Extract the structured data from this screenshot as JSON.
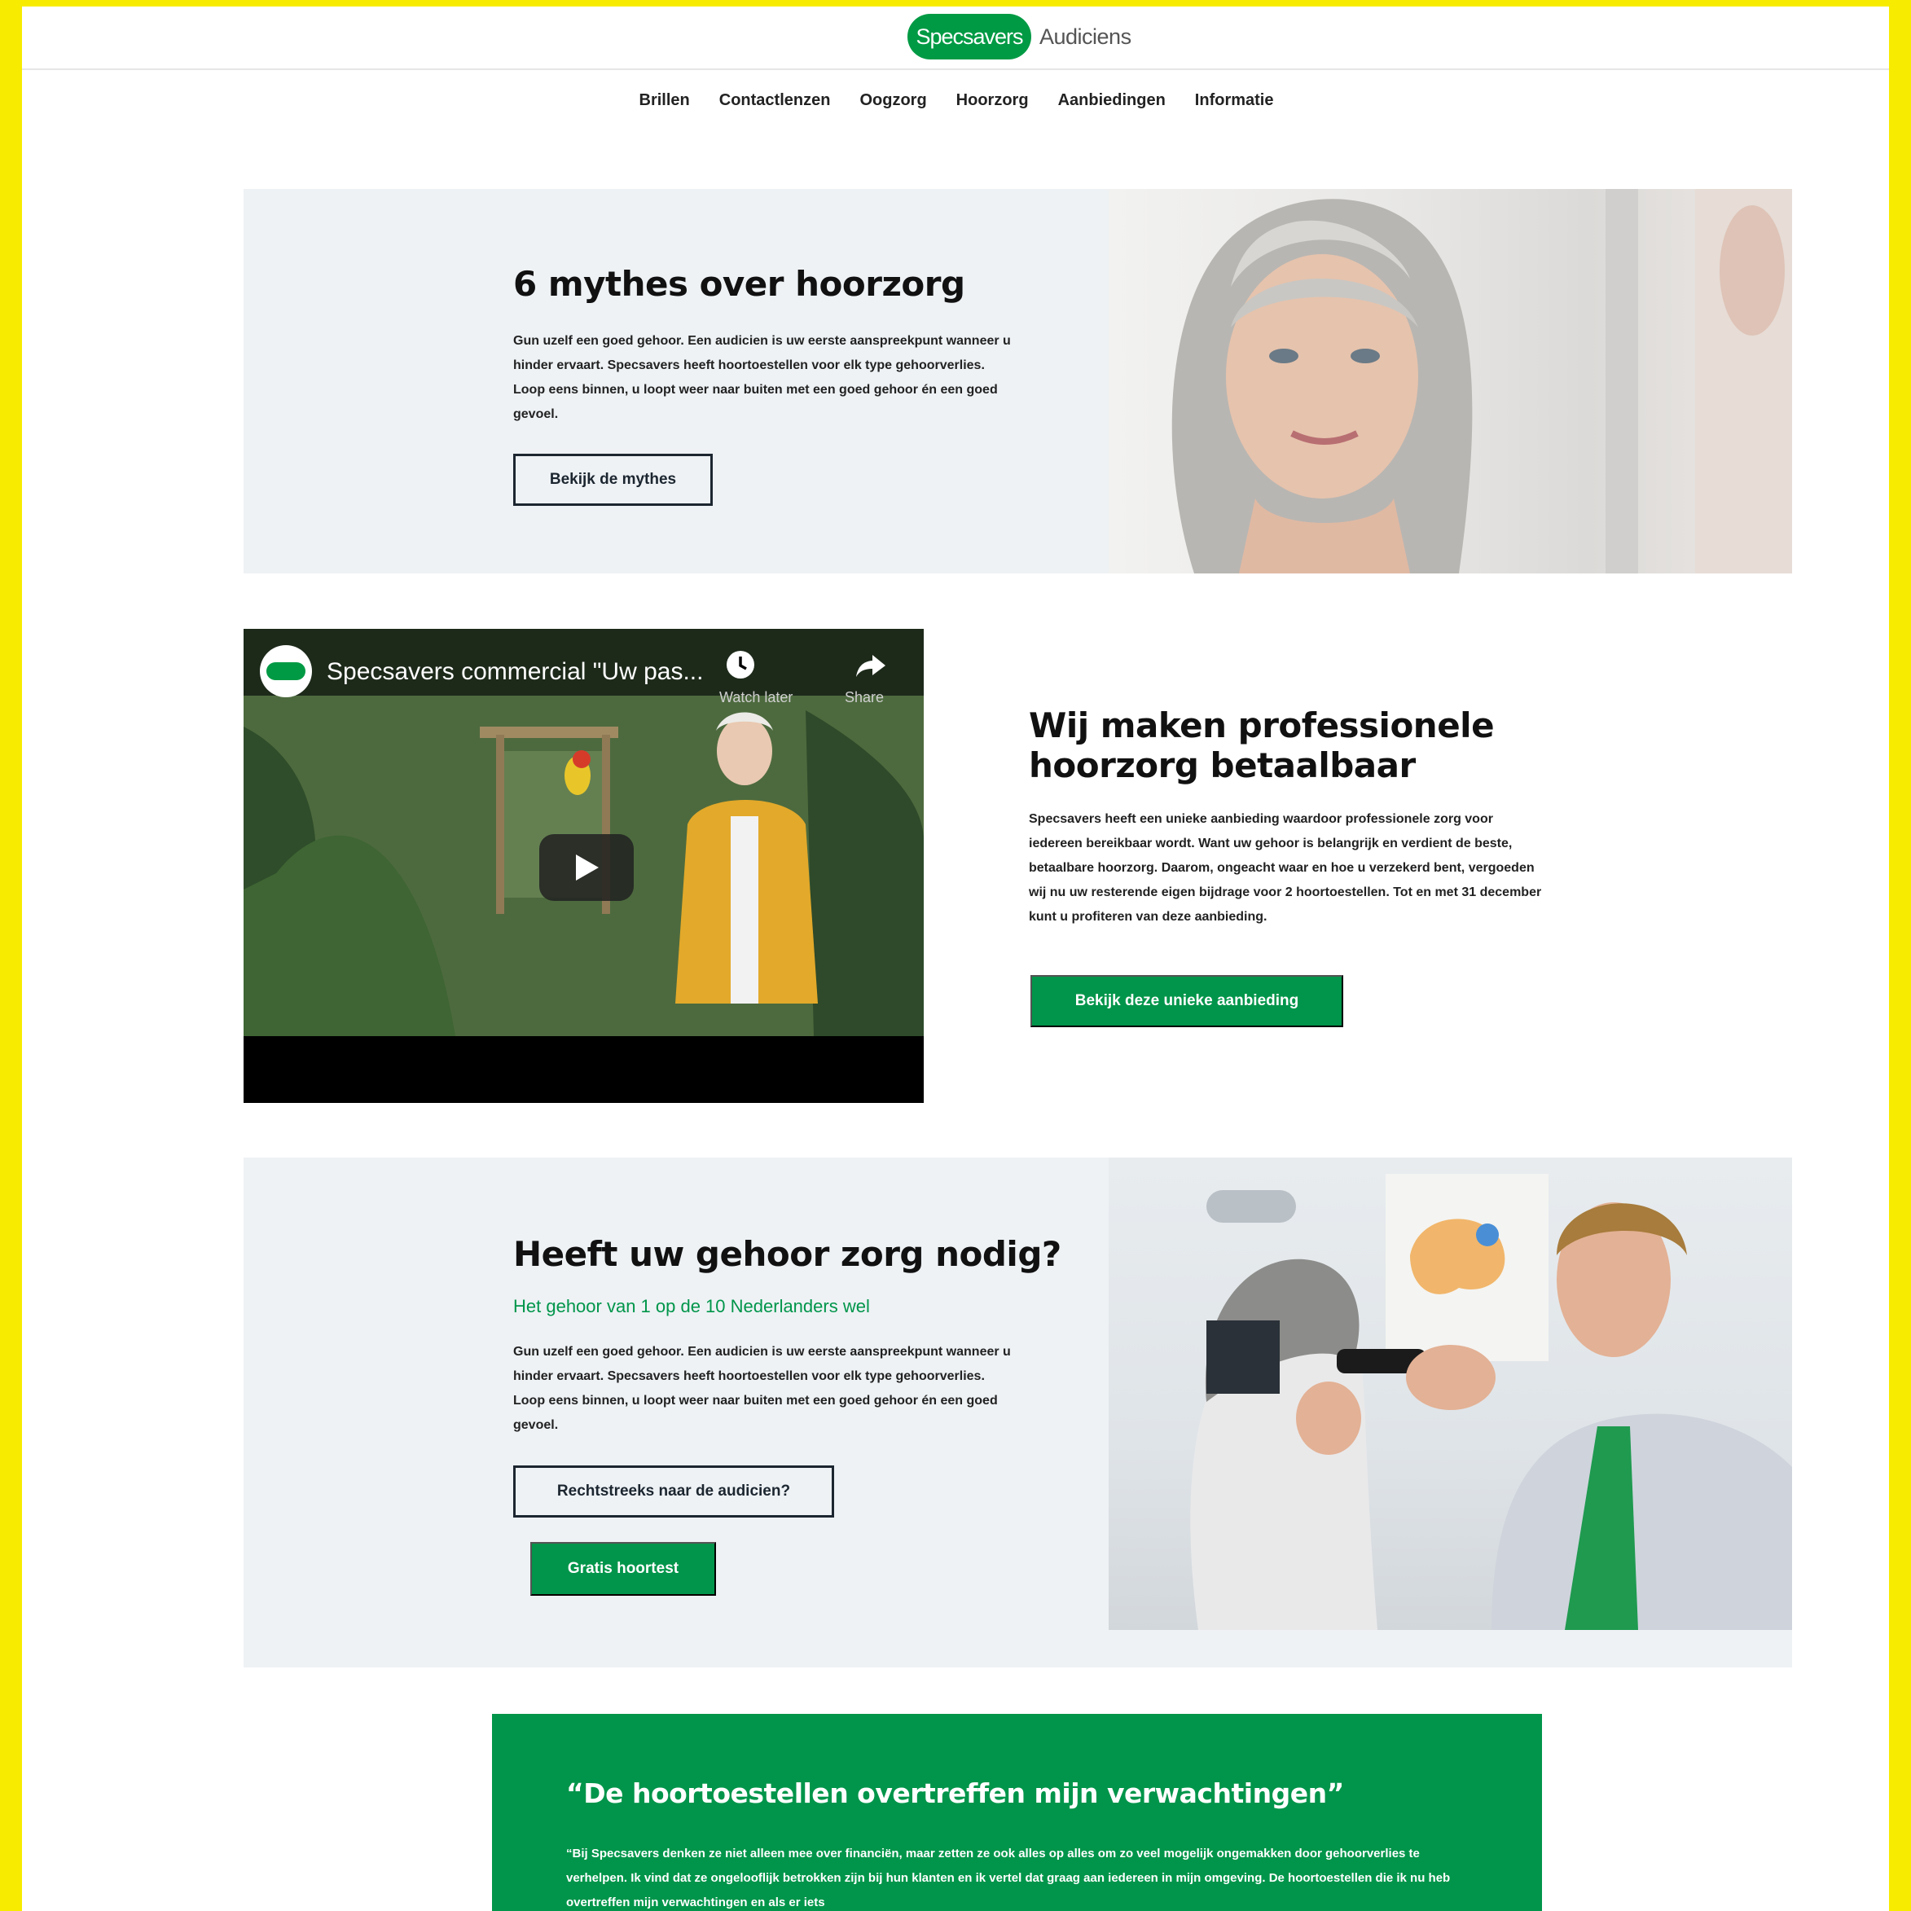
{
  "header": {
    "logo_brand": "Specsavers",
    "logo_sub": "Audiciens",
    "nav": [
      "Brillen",
      "Contactlenzen",
      "Oogzorg",
      "Hoorzorg",
      "Aanbiedingen",
      "Informatie"
    ]
  },
  "section_myths": {
    "title": "6 mythes over hoorzorg",
    "body": "Gun uzelf een goed gehoor. Een audicien is uw eerste aanspreekpunt wanneer u hinder ervaart. Specsavers heeft hoortoestellen voor elk type gehoorverlies. Loop eens binnen, u loopt weer naar buiten met een goed gehoor én een goed gevoel.",
    "button": "Bekijk de mythes"
  },
  "section_video": {
    "video_title": "Specsavers commercial \"Uw pas...",
    "watch_later": "Watch later",
    "share": "Share",
    "channel_logo_text": "Specsavers"
  },
  "section_affordable": {
    "title": "Wij maken professionele hoorzorg betaalbaar",
    "body": "Specsavers heeft een unieke aanbieding waardoor professionele zorg voor iedereen bereikbaar wordt. Want uw gehoor is belangrijk en verdient de beste, betaalbare hoorzorg. Daarom, ongeacht waar en hoe u verzekerd bent, vergoeden wij nu uw resterende eigen bijdrage voor 2 hoortoestellen. Tot en met 31 december kunt u profiteren van deze aanbieding.",
    "button": "Bekijk deze unieke aanbieding"
  },
  "section_care": {
    "title": "Heeft uw gehoor zorg nodig?",
    "subtitle": "Het gehoor van 1 op de 10 Nederlanders wel",
    "body": "Gun uzelf een goed gehoor. Een audicien is uw eerste aanspreekpunt wanneer u hinder ervaart. Specsavers heeft hoortoestellen voor elk type gehoorverlies. Loop eens binnen, u loopt weer naar buiten met een goed gehoor én een goed gevoel.",
    "button_outline": "Rechtstreeks naar de audicien?",
    "button_green": "Gratis hoortest"
  },
  "testimonial": {
    "title": "“De hoortoestellen overtreffen mijn verwachtingen”",
    "body": "“Bij Specsavers denken ze niet alleen mee over financiën, maar zetten ze ook alles op alles om zo veel mogelijk ongemakken door gehoorverlies te verhelpen. Ik vind dat ze ongelooflijk betrokken zijn bij hun klanten en ik vertel dat graag aan iedereen in mijn omgeving. De hoortoestellen die ik nu heb overtreffen mijn verwachtingen en als er iets"
  },
  "colors": {
    "frame": "#f7ec00",
    "brand_green": "#00954a",
    "panel": "#eef2f5"
  }
}
